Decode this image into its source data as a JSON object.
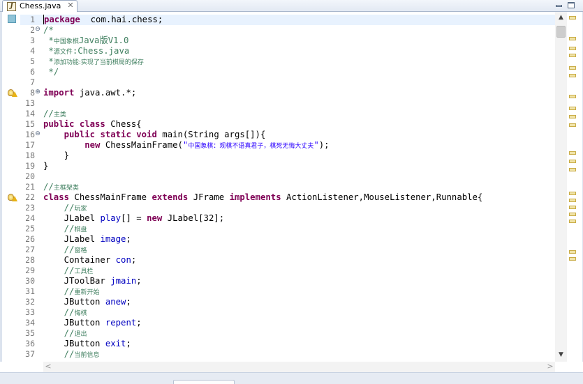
{
  "tab": {
    "title": "Chess.java",
    "icon": "java-file-icon",
    "close_icon": "close-icon",
    "close_glyph": "✕"
  },
  "scrollbar": {
    "up_glyph": "▲",
    "down_glyph": "▼",
    "left_glyph": "<",
    "right_glyph": ">"
  },
  "colors": {
    "keyword": "#7f0055",
    "comment": "#3f7f5f",
    "string": "#2a00ff",
    "field": "#0000c0",
    "current_line": "#e8f2fe"
  },
  "editor": {
    "lines": [
      {
        "n": "1",
        "fold": "",
        "segs": [
          [
            "caret",
            ""
          ],
          [
            "kw",
            "package"
          ],
          [
            "",
            "  com.hai.chess;"
          ]
        ],
        "current": true
      },
      {
        "n": "2",
        "fold": "⊖",
        "segs": [
          [
            "cm",
            "/*"
          ]
        ]
      },
      {
        "n": "3",
        "fold": "",
        "segs": [
          [
            "cm",
            " *"
          ],
          [
            "cmsmall",
            "中国象棋"
          ],
          [
            "cm",
            "Java版V1.0"
          ]
        ]
      },
      {
        "n": "4",
        "fold": "",
        "segs": [
          [
            "cm",
            " *"
          ],
          [
            "cmsmall",
            "源文件"
          ],
          [
            "cm",
            ":Chess.java"
          ]
        ]
      },
      {
        "n": "5",
        "fold": "",
        "segs": [
          [
            "cm",
            " *"
          ],
          [
            "cmsmall",
            "添加功能:实现了当前棋局的保存"
          ]
        ]
      },
      {
        "n": "6",
        "fold": "",
        "segs": [
          [
            "cm",
            " */"
          ]
        ]
      },
      {
        "n": "7",
        "fold": "",
        "segs": []
      },
      {
        "n": "8",
        "fold": "⊕",
        "segs": [
          [
            "kw",
            "import"
          ],
          [
            "",
            " java.awt.*;"
          ]
        ]
      },
      {
        "n": "13",
        "fold": "",
        "segs": []
      },
      {
        "n": "14",
        "fold": "",
        "segs": [
          [
            "cm",
            "//"
          ],
          [
            "cmsmall",
            "主类"
          ]
        ]
      },
      {
        "n": "15",
        "fold": "",
        "segs": [
          [
            "kw",
            "public class"
          ],
          [
            "",
            " Chess{"
          ]
        ]
      },
      {
        "n": "16",
        "fold": "⊖",
        "segs": [
          [
            "",
            "    "
          ],
          [
            "kw",
            "public static void"
          ],
          [
            "",
            " main(String args[]){"
          ]
        ]
      },
      {
        "n": "17",
        "fold": "",
        "segs": [
          [
            "",
            "        "
          ],
          [
            "kw",
            "new"
          ],
          [
            "",
            " ChessMainFrame("
          ],
          [
            "str",
            "\""
          ],
          [
            "strsmall",
            "中国象棋：观棋不语真君子，棋死无悔大丈夫"
          ],
          [
            "str",
            "\""
          ],
          [
            "",
            ");"
          ]
        ]
      },
      {
        "n": "18",
        "fold": "",
        "segs": [
          [
            "",
            "    }"
          ]
        ]
      },
      {
        "n": "19",
        "fold": "",
        "segs": [
          [
            "",
            "}"
          ]
        ]
      },
      {
        "n": "20",
        "fold": "",
        "segs": []
      },
      {
        "n": "21",
        "fold": "",
        "segs": [
          [
            "cm",
            "//"
          ],
          [
            "cmsmall",
            "主框架类"
          ]
        ]
      },
      {
        "n": "22",
        "fold": "",
        "segs": [
          [
            "kw",
            "class"
          ],
          [
            "",
            " ChessMainFrame "
          ],
          [
            "kw",
            "extends"
          ],
          [
            "",
            " JFrame "
          ],
          [
            "kw",
            "implements"
          ],
          [
            "",
            " ActionListener,MouseListener,Runnable{"
          ]
        ]
      },
      {
        "n": "23",
        "fold": "",
        "segs": [
          [
            "",
            "    "
          ],
          [
            "cm",
            "//"
          ],
          [
            "cmsmall",
            "玩家"
          ]
        ]
      },
      {
        "n": "24",
        "fold": "",
        "segs": [
          [
            "",
            "    JLabel "
          ],
          [
            "fld",
            "play"
          ],
          [
            "",
            "[] = "
          ],
          [
            "kw",
            "new"
          ],
          [
            "",
            " JLabel[32];"
          ]
        ]
      },
      {
        "n": "25",
        "fold": "",
        "segs": [
          [
            "",
            "    "
          ],
          [
            "cm",
            "//"
          ],
          [
            "cmsmall",
            "棋盘"
          ]
        ]
      },
      {
        "n": "26",
        "fold": "",
        "segs": [
          [
            "",
            "    JLabel "
          ],
          [
            "fld",
            "image"
          ],
          [
            "",
            ";"
          ]
        ]
      },
      {
        "n": "27",
        "fold": "",
        "segs": [
          [
            "",
            "    "
          ],
          [
            "cm",
            "//"
          ],
          [
            "cmsmall",
            "窗格"
          ]
        ]
      },
      {
        "n": "28",
        "fold": "",
        "segs": [
          [
            "",
            "    Container "
          ],
          [
            "fld",
            "con"
          ],
          [
            "",
            ";"
          ]
        ]
      },
      {
        "n": "29",
        "fold": "",
        "segs": [
          [
            "",
            "    "
          ],
          [
            "cm",
            "//"
          ],
          [
            "cmsmall",
            "工具栏"
          ]
        ]
      },
      {
        "n": "30",
        "fold": "",
        "segs": [
          [
            "",
            "    JToolBar "
          ],
          [
            "fld",
            "jmain"
          ],
          [
            "",
            ";"
          ]
        ]
      },
      {
        "n": "31",
        "fold": "",
        "segs": [
          [
            "",
            "    "
          ],
          [
            "cm",
            "//"
          ],
          [
            "cmsmall",
            "重新开始"
          ]
        ]
      },
      {
        "n": "32",
        "fold": "",
        "segs": [
          [
            "",
            "    JButton "
          ],
          [
            "fld",
            "anew"
          ],
          [
            "",
            ";"
          ]
        ]
      },
      {
        "n": "33",
        "fold": "",
        "segs": [
          [
            "",
            "    "
          ],
          [
            "cm",
            "//"
          ],
          [
            "cmsmall",
            "悔棋"
          ]
        ]
      },
      {
        "n": "34",
        "fold": "",
        "segs": [
          [
            "",
            "    JButton "
          ],
          [
            "fld",
            "repent"
          ],
          [
            "",
            ";"
          ]
        ]
      },
      {
        "n": "35",
        "fold": "",
        "segs": [
          [
            "",
            "    "
          ],
          [
            "cm",
            "//"
          ],
          [
            "cmsmall",
            "退出"
          ]
        ]
      },
      {
        "n": "36",
        "fold": "",
        "segs": [
          [
            "",
            "    JButton "
          ],
          [
            "fld",
            "exit"
          ],
          [
            "",
            ";"
          ]
        ]
      },
      {
        "n": "37",
        "fold": "",
        "segs": [
          [
            "",
            "    "
          ],
          [
            "cm",
            "//"
          ],
          [
            "cmsmall",
            "当前信息"
          ]
        ]
      }
    ]
  }
}
